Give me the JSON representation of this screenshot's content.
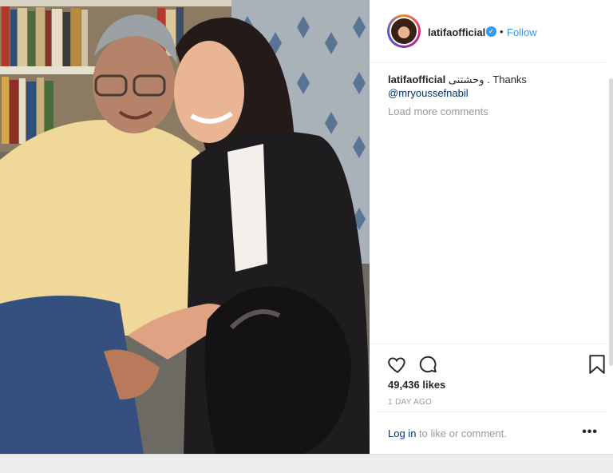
{
  "post": {
    "username": "latifaofficial",
    "verified_icon": "verified-badge-icon",
    "separator": "•",
    "follow_label": "Follow",
    "caption_username": "latifaofficial",
    "caption_text": "وحشتنى . Thanks",
    "caption_mention": "@mryoussefnabil",
    "load_more_label": "Load more comments",
    "likes": "49,436 likes",
    "timestamp": "1 DAY AGO",
    "login_link": "Log in",
    "login_suffix": " to like or comment.",
    "more_label": "•••"
  },
  "colors": {
    "link_blue": "#3897f0",
    "mention_blue": "#003569",
    "muted_gray": "#999999",
    "text": "#262626"
  },
  "icons": [
    "heart-icon",
    "comment-icon",
    "bookmark-icon",
    "more-options-icon"
  ]
}
